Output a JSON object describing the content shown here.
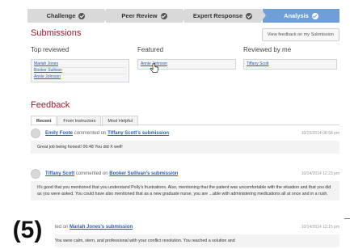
{
  "steps": [
    {
      "label": "Challenge",
      "active": false
    },
    {
      "label": "Peer Review",
      "active": false
    },
    {
      "label": "Expert Response",
      "active": false
    },
    {
      "label": "Analysis",
      "active": true
    }
  ],
  "submissions": {
    "title": "Submissions",
    "view_feedback_button": "View feedback on my Submission",
    "top_reviewed": {
      "heading": "Top reviewed",
      "items": [
        "Mariah Jones",
        "Booker Sullivan",
        "Annie Johnson"
      ]
    },
    "featured": {
      "heading": "Featured",
      "items": [
        "Annie Johnson"
      ]
    },
    "reviewed_by_me": {
      "heading": "Reviewed by me",
      "items": [
        "Tiffany Scott"
      ]
    }
  },
  "feedback": {
    "title": "Feedback",
    "tabs": [
      "Recent",
      "From Instructors",
      "Most Helpful"
    ],
    "comments": [
      {
        "author": "Emily Foote",
        "verb": "commented on",
        "target": "Tiffany Scott's submission",
        "timestamp": "10/15/2014 08:58 pm",
        "body": "Great job being honest! 00:48 You did X well!"
      },
      {
        "author": "Tiffany Scott",
        "verb": "commented on",
        "target": "Booker Sullivan's submission",
        "timestamp": "10/14/2014 12:23 pm",
        "body": "It's good that you mentioned that you understand Polly's frustrations. Also, mentioning that the patient was uncomfortable with the situation and that you did as you were asked. You could have also mentioned that as a new graduate nurse, you are ...able with administering medications all at once and in a rush."
      },
      {
        "author": "",
        "verb": "...ented on",
        "target": "Mariah Jones's submission",
        "timestamp": "10/14/2014 12:15 pm",
        "body": "...ponse! You were calm, stern, and professional with your conflict resolution. You reached a solution and"
      }
    ]
  },
  "figure_label": "(5)"
}
